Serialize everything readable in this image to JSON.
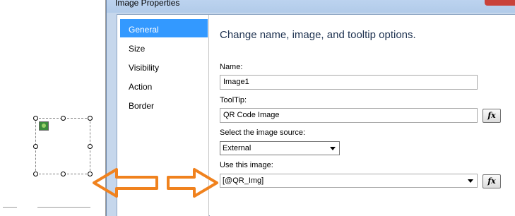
{
  "dialog": {
    "title": "Image Properties",
    "heading": "Change name, image, and tooltip options.",
    "nav_items": [
      {
        "label": "General",
        "selected": true
      },
      {
        "label": "Size",
        "selected": false
      },
      {
        "label": "Visibility",
        "selected": false
      },
      {
        "label": "Action",
        "selected": false
      },
      {
        "label": "Border",
        "selected": false
      }
    ],
    "name_label": "Name:",
    "name_value": "Image1",
    "tooltip_label": "ToolTip:",
    "tooltip_value": "QR Code Image",
    "source_label": "Select the image source:",
    "source_value": "External",
    "use_image_label": "Use this image:",
    "use_image_value": "[@QR_Img]",
    "fx_label": "fx"
  },
  "colors": {
    "selected_nav": "#3399ff",
    "annotation_arrow": "#f0821e",
    "dialog_frame": "#c6d7ec"
  },
  "icons": [
    "image-placeholder-icon",
    "dropdown-arrow-icon",
    "expression-fx-icon",
    "close-icon"
  ]
}
